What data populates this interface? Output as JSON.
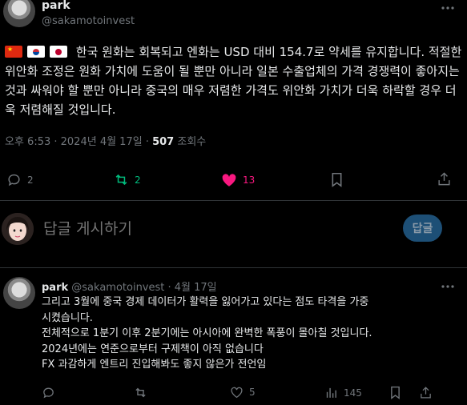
{
  "main_post": {
    "author_name": "park",
    "author_handle": "@sakamotoinvest",
    "text": "한국 원화는 회복되고 엔화는 USD 대비 154.7로 약세를 유지합니다. 적절한 위안화 조정은 원화 가치에 도움이 될 뿐만 아니라 일본 수출업체의 가격 경쟁력이 좋아지는 것과 싸워야 할 뿐만 아니라 중국의 매우 저렴한 가격도 위안화 가치가 더욱 하락할 경우 더욱 저렴해질 것입니다.",
    "flags": [
      "flag-china",
      "flag-south-korea",
      "flag-japan"
    ],
    "meta_time": "오후 6:53 · 2024년 4월 17일 · ",
    "views_count": "507",
    "views_label": " 조회수",
    "actions": {
      "reply_count": "2",
      "repost_count": "2",
      "like_count": "13"
    }
  },
  "reply_box": {
    "placeholder": "답글 게시하기",
    "button_label": "답글"
  },
  "reply_post": {
    "author_name": "park",
    "author_handle": "@sakamotoinvest",
    "date": "· 4월 17일",
    "lines": [
      "그리고 3월에 중국 경제 데이터가  활력을 잃어가고 있다는 점도 타격을 가중",
      "시켰습니다.",
      "전체적으로 1분기 이후 2분기에는 아시아에 완벽한 폭풍이 몰아칠 것입니다.",
      "2024년에는 연준으로부터 구제책이 아직 없습니다",
      "FX 과감하게 엔트리 진입해봐도 좋지 않은가 전언임"
    ],
    "actions": {
      "like_count": "5",
      "views_count": "145"
    }
  },
  "colors": {
    "background": "#000000",
    "text": "#e7e9ea",
    "muted": "#71767b",
    "repost_green": "#00ba7c",
    "like_pink": "#f91880",
    "button_bg": "#1d4f76",
    "divider": "#2f3336"
  }
}
